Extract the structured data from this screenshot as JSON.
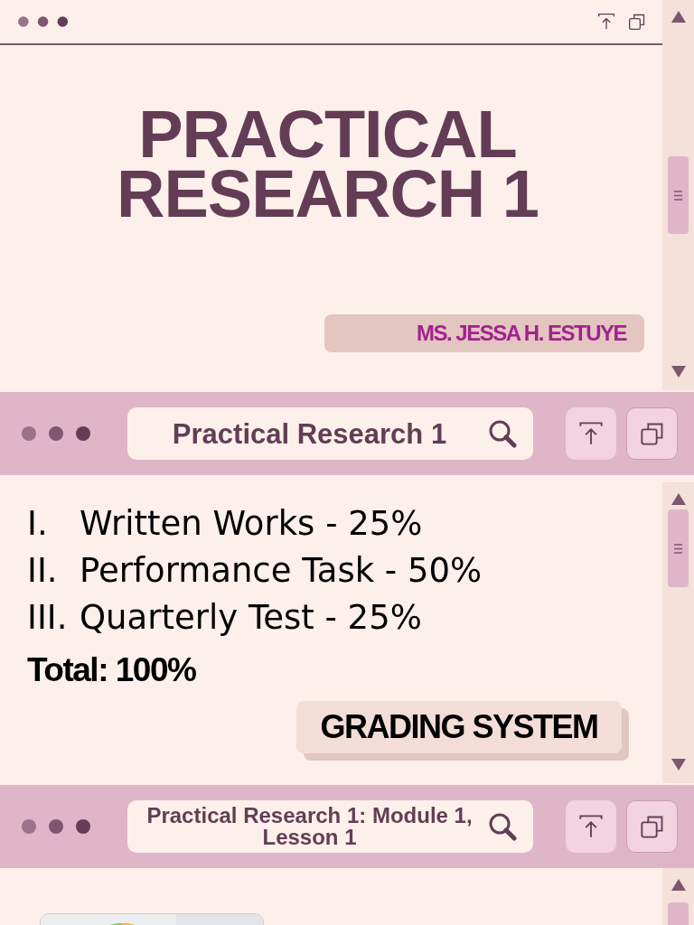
{
  "slides": [
    {
      "kind": "title",
      "title_lines": [
        "PRACTICAL",
        "RESEARCH 1"
      ],
      "author": "MS. JESSA H. ESTUYE"
    },
    {
      "kind": "list",
      "search": "Practical Research 1",
      "items": [
        {
          "number": "I.",
          "text": "Written Works - 25%"
        },
        {
          "number": "II.",
          "text": "Performance Task - 50%"
        },
        {
          "number": "III.",
          "text": "Quarterly Test - 25%"
        }
      ],
      "total": "Total: 100%",
      "label": "GRADING SYSTEM"
    },
    {
      "kind": "picture",
      "search": "Practical Research 1: Module 1, Lesson 1"
    }
  ]
}
